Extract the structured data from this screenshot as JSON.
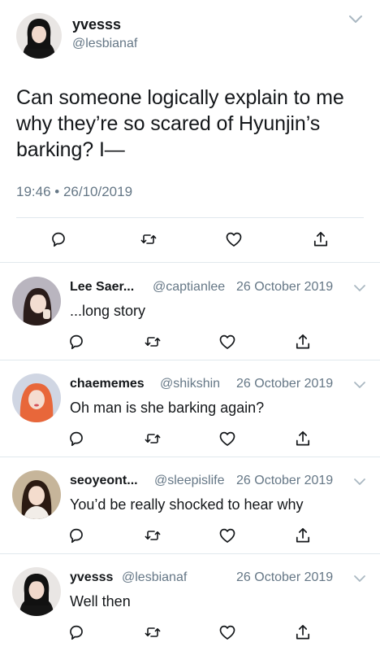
{
  "main_tweet": {
    "author_name": "yvesss",
    "author_handle": "@lesbianaf",
    "text": "Can someone logically explain to me why they’re so scared of Hyunjin’s barking? I—",
    "timestamp": "19:46 • 26/10/2019",
    "actions": [
      "reply-icon",
      "retweet-icon",
      "like-icon",
      "share-icon"
    ]
  },
  "replies": [
    {
      "name": "Lee Saer...",
      "handle": "@captianlee",
      "date": "26 October 2019",
      "text": "...long story",
      "avatar_hair": "#2a1c1a"
    },
    {
      "name": "chaememes",
      "handle": "@shikshin",
      "date": "26 October 2019",
      "text": "Oh man is she barking again?",
      "avatar_hair": "#e8673a"
    },
    {
      "name": "seoyeont...",
      "handle": "@sleepislife",
      "date": "26 October 2019",
      "text": "You’d be really shocked to hear why",
      "avatar_hair": "#2b1a12"
    },
    {
      "name": "yvesss",
      "handle": "@lesbianaf",
      "date": "26 October 2019",
      "text": "Well then",
      "avatar_hair": "#111111"
    }
  ],
  "colors": {
    "text": "#14171a",
    "secondary": "#657786",
    "divider": "#e1e8ed"
  }
}
